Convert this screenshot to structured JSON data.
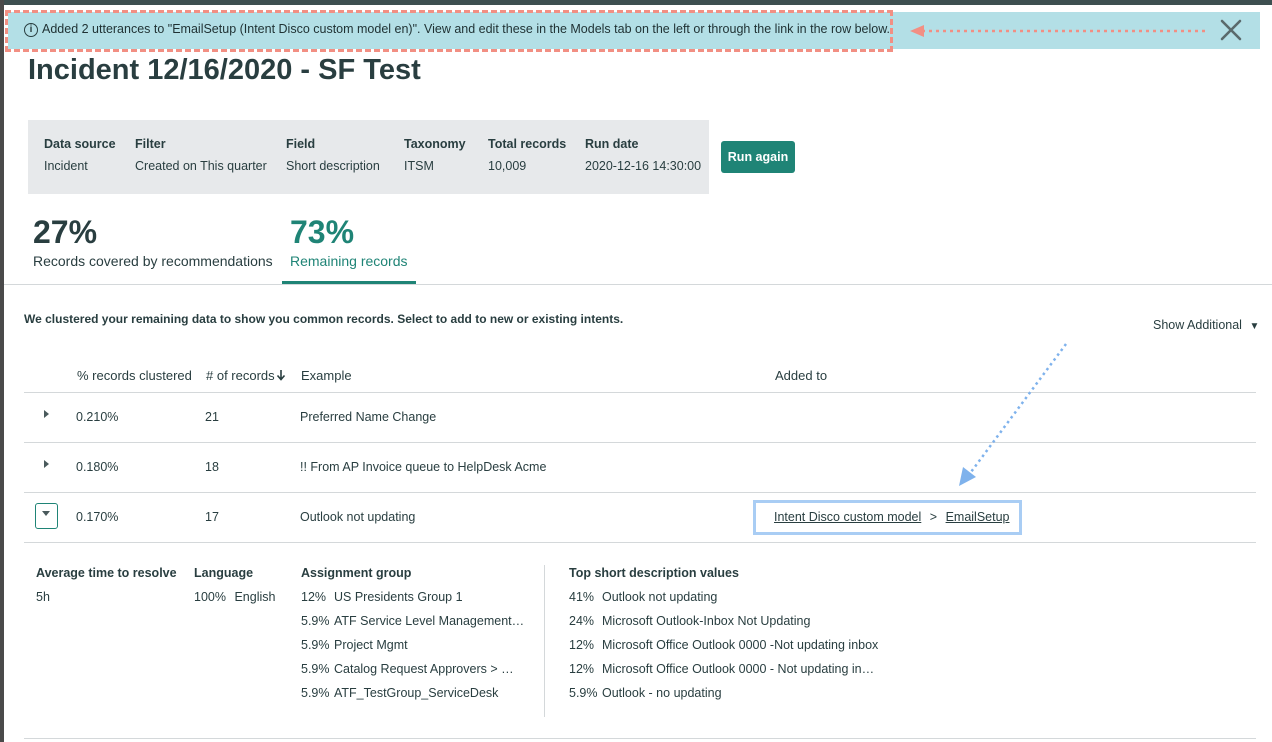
{
  "notification": {
    "message": "Added 2 utterances to \"EmailSetup (Intent Disco custom model en)\". View and edit these in the Models tab on the left or through the link in the row below."
  },
  "page_title": "Incident 12/16/2020 - SF Test",
  "run_info": {
    "data_source": {
      "label": "Data source",
      "value": "Incident"
    },
    "filter": {
      "label": "Filter",
      "value": "Created on This quarter"
    },
    "field": {
      "label": "Field",
      "value": "Short description"
    },
    "taxonomy": {
      "label": "Taxonomy",
      "value": "ITSM"
    },
    "total_records": {
      "label": "Total records",
      "value": "10,009"
    },
    "run_date": {
      "label": "Run date",
      "value": "2020-12-16 14:30:00"
    }
  },
  "run_again_label": "Run again",
  "stats": {
    "covered": {
      "pct": "27%",
      "caption": "Records covered by recommendations"
    },
    "remaining": {
      "pct": "73%",
      "caption": "Remaining records"
    }
  },
  "cluster_message": "We clustered your remaining data to show you common records. Select to add to new or existing intents.",
  "show_additional": "Show Additional",
  "table": {
    "headers": {
      "pct": "% records clustered",
      "count": "# of records",
      "example": "Example",
      "added_to": "Added to"
    },
    "rows": [
      {
        "pct": "0.210%",
        "count": "21",
        "example": "Preferred Name Change"
      },
      {
        "pct": "0.180%",
        "count": "18",
        "example": "!! From AP Invoice queue to HelpDesk Acme"
      },
      {
        "pct": "0.170%",
        "count": "17",
        "example": "Outlook not updating",
        "added_model": "Intent Disco custom model",
        "added_sep": ">",
        "added_intent": "EmailSetup"
      }
    ]
  },
  "details": {
    "avg_time": {
      "label": "Average time to resolve",
      "value": "5h"
    },
    "language": {
      "label": "Language",
      "pct": "100%",
      "value": "English"
    },
    "assignment": {
      "label": "Assignment group",
      "items": [
        {
          "pct": "12%",
          "value": "US Presidents Group 1"
        },
        {
          "pct": "5.9%",
          "value": "ATF Service Level Management…"
        },
        {
          "pct": "5.9%",
          "value": "Project Mgmt"
        },
        {
          "pct": "5.9%",
          "value": "Catalog Request Approvers > …"
        },
        {
          "pct": "5.9%",
          "value": "ATF_TestGroup_ServiceDesk"
        }
      ]
    },
    "top_short": {
      "label": "Top short description values",
      "items": [
        {
          "pct": "41%",
          "value": "Outlook not updating"
        },
        {
          "pct": "24%",
          "value": "Microsoft Outlook-Inbox Not Updating"
        },
        {
          "pct": "12%",
          "value": "Microsoft Office Outlook 0000 -Not updating inbox"
        },
        {
          "pct": "12%",
          "value": "Microsoft Office Outlook 0000 - Not updating in…"
        },
        {
          "pct": "5.9%",
          "value": "Outlook - no updating"
        }
      ]
    }
  }
}
